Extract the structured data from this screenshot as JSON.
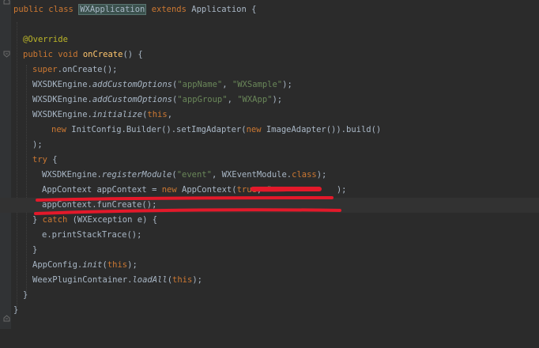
{
  "colors": {
    "background": "#2b2b2b",
    "keyword": "#cc7832",
    "annotation": "#bbb529",
    "string": "#6a8759",
    "method_decl": "#ffc66d",
    "default_text": "#a9b7c6",
    "red_underline": "#e3192a"
  },
  "code": {
    "l1": {
      "kw": "public class ",
      "name": "WXApplication",
      "kw2": " extends ",
      "rest": "Application {"
    },
    "l2": {
      "ann": "@Override"
    },
    "l3": {
      "kw": "public void ",
      "fn": "onCreate",
      "rest": "() {"
    },
    "l4": {
      "kw": "super",
      "rest": ".onCreate();"
    },
    "l5": {
      "a": "WXSDKEngine.",
      "it": "addCustomOptions",
      "b": "(",
      "s1": "\"appName\"",
      "c": ", ",
      "s2": "\"WXSample\"",
      "d": ");"
    },
    "l6": {
      "a": "WXSDKEngine.",
      "it": "addCustomOptions",
      "b": "(",
      "s1": "\"appGroup\"",
      "c": ", ",
      "s2": "\"WXApp\"",
      "d": ");"
    },
    "l7": {
      "a": "WXSDKEngine.",
      "it": "initialize",
      "b": "(",
      "kw": "this",
      "c": ","
    },
    "l8": {
      "kw": "new ",
      "a": "InitConfig.Builder().setImgAdapter(",
      "kw2": "new ",
      "b": "ImageAdapter()).build()"
    },
    "l9": {
      "a": ");"
    },
    "l10": {
      "kw": "try",
      "a": " {"
    },
    "l11": {
      "a": "WXSDKEngine.",
      "it": "registerModule",
      "b": "(",
      "s1": "\"event\"",
      "c": ", WXEventModule.",
      "kw": "class",
      "d": ");"
    },
    "l12": {
      "a": "AppContext appContext = ",
      "kw": "new ",
      "b": "AppContext(",
      "kw2": "true",
      "c": ", ",
      "s1": "\"",
      "d": ");"
    },
    "l13": {
      "a": "appContext.funCreate();"
    },
    "l14": {
      "a": "} ",
      "kw": "catch",
      "b": " (WXException e) {"
    },
    "l15": {
      "a": "e.printStackTrace();"
    },
    "l16": {
      "a": "}"
    },
    "l17": {
      "a": "AppConfig.",
      "it": "init",
      "b": "(",
      "kw": "this",
      "c": ");"
    },
    "l18": {
      "a": "WeexPluginContainer.",
      "it": "loadAll",
      "b": "(",
      "kw": "this",
      "c": ");"
    },
    "l19": {
      "a": "}"
    },
    "l20": {
      "a": "}"
    }
  }
}
